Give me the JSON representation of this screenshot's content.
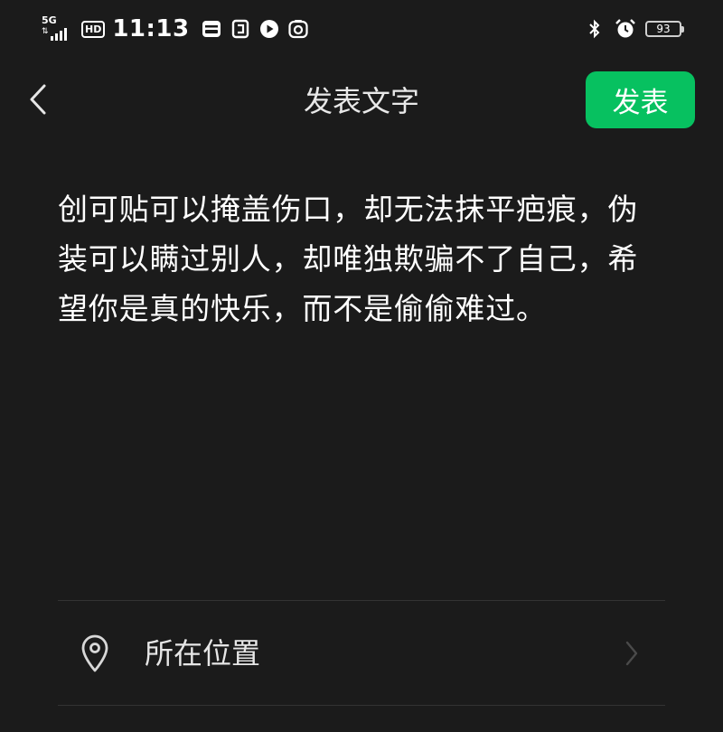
{
  "status_bar": {
    "network": "5G",
    "hd_label": "HD",
    "time": "11:13",
    "battery": "93",
    "icons": [
      "sim-card-icon",
      "clipboard-icon",
      "play-icon",
      "camera-icon",
      "bluetooth-icon",
      "alarm-icon",
      "battery-icon"
    ]
  },
  "header": {
    "back_icon": "back-chevron-icon",
    "title": "发表文字",
    "publish_label": "发表",
    "publish_color": "#07c160"
  },
  "post": {
    "text": "创可贴可以掩盖伤口，却无法抹平疤痕，伪装可以瞒过别人，却唯独欺骗不了自己，希望你是真的快乐，而不是偷偷难过。"
  },
  "location": {
    "icon": "location-pin-icon",
    "label": "所在位置",
    "chevron": "chevron-right-icon"
  },
  "colors": {
    "background": "#1b1b1b",
    "accent": "#07c160",
    "divider": "#333333"
  }
}
